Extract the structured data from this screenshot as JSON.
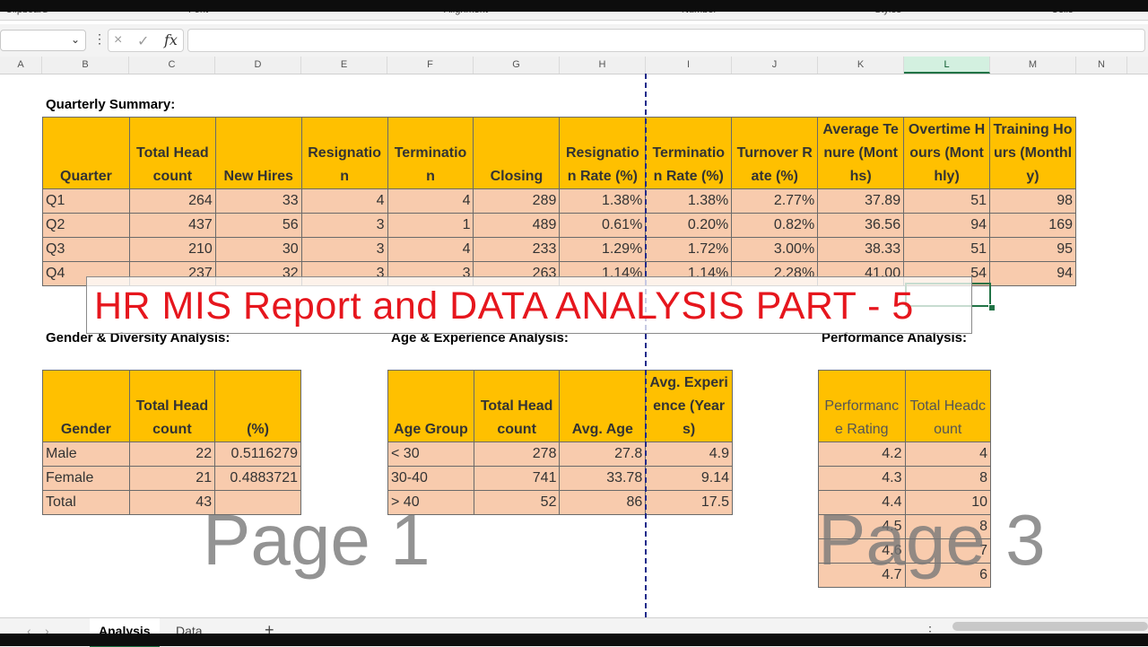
{
  "ribbon": {
    "groups": [
      "Clipboard",
      "Font",
      "Alignment",
      "Number",
      "Styles",
      "Cells"
    ]
  },
  "formula_bar": {
    "name_box": "",
    "cancel_icon": "×",
    "enter_icon": "✓",
    "fx_label": "fx",
    "formula": ""
  },
  "columns": [
    "A",
    "B",
    "C",
    "D",
    "E",
    "F",
    "G",
    "H",
    "I",
    "J",
    "K",
    "L",
    "M",
    "N"
  ],
  "quarterly": {
    "title": "Quarterly Summary:",
    "headers": [
      "Quarter",
      "Total Headcount",
      "New Hires",
      "Resignation",
      "Termination",
      "Closing",
      "Resignation Rate (%)",
      "Termination Rate (%)",
      "Turnover Rate (%)",
      "Average Tenure (Months)",
      "Overtime Hours (Monthly)",
      "Training Hours (Monthly)"
    ],
    "rows": [
      [
        "Q1",
        "264",
        "33",
        "4",
        "4",
        "289",
        "1.38%",
        "1.38%",
        "2.77%",
        "37.89",
        "51",
        "98"
      ],
      [
        "Q2",
        "437",
        "56",
        "3",
        "1",
        "489",
        "0.61%",
        "0.20%",
        "0.82%",
        "36.56",
        "94",
        "169"
      ],
      [
        "Q3",
        "210",
        "30",
        "3",
        "4",
        "233",
        "1.29%",
        "1.72%",
        "3.00%",
        "38.33",
        "51",
        "95"
      ],
      [
        "Q4",
        "237",
        "32",
        "3",
        "3",
        "263",
        "1.14%",
        "1.14%",
        "2.28%",
        "41.00",
        "54",
        "94"
      ]
    ]
  },
  "gender": {
    "title": "Gender & Diversity Analysis:",
    "headers": [
      "Gender",
      "Total Headcount",
      "(%)"
    ],
    "rows": [
      [
        "Male",
        "22",
        "0.5116279"
      ],
      [
        "Female",
        "21",
        "0.4883721"
      ],
      [
        "Total",
        "43",
        ""
      ]
    ]
  },
  "age": {
    "title": "Age & Experience Analysis:",
    "headers": [
      "Age Group",
      "Total Headcount",
      "Avg. Age",
      "Avg. Experience (Years)"
    ],
    "rows": [
      [
        "< 30",
        "278",
        "27.8",
        "4.9"
      ],
      [
        "30-40",
        "741",
        "33.78",
        "9.14"
      ],
      [
        "> 40",
        "52",
        "86",
        "17.5"
      ]
    ]
  },
  "performance": {
    "title": "Performance Analysis:",
    "headers": [
      "Performance Rating",
      "Total Headcount"
    ],
    "rows": [
      [
        "4.2",
        "4"
      ],
      [
        "4.3",
        "8"
      ],
      [
        "4.4",
        "10"
      ],
      [
        "4.5",
        "8"
      ],
      [
        "4.6",
        "7"
      ],
      [
        "4.7",
        "6"
      ]
    ]
  },
  "overlay_title": "HR MIS Report and DATA ANALYSIS PART - 5",
  "watermarks": [
    "Page 1",
    "Page 3"
  ],
  "sheets": {
    "tabs": [
      "Analysis",
      "Data"
    ],
    "add_label": "+"
  }
}
